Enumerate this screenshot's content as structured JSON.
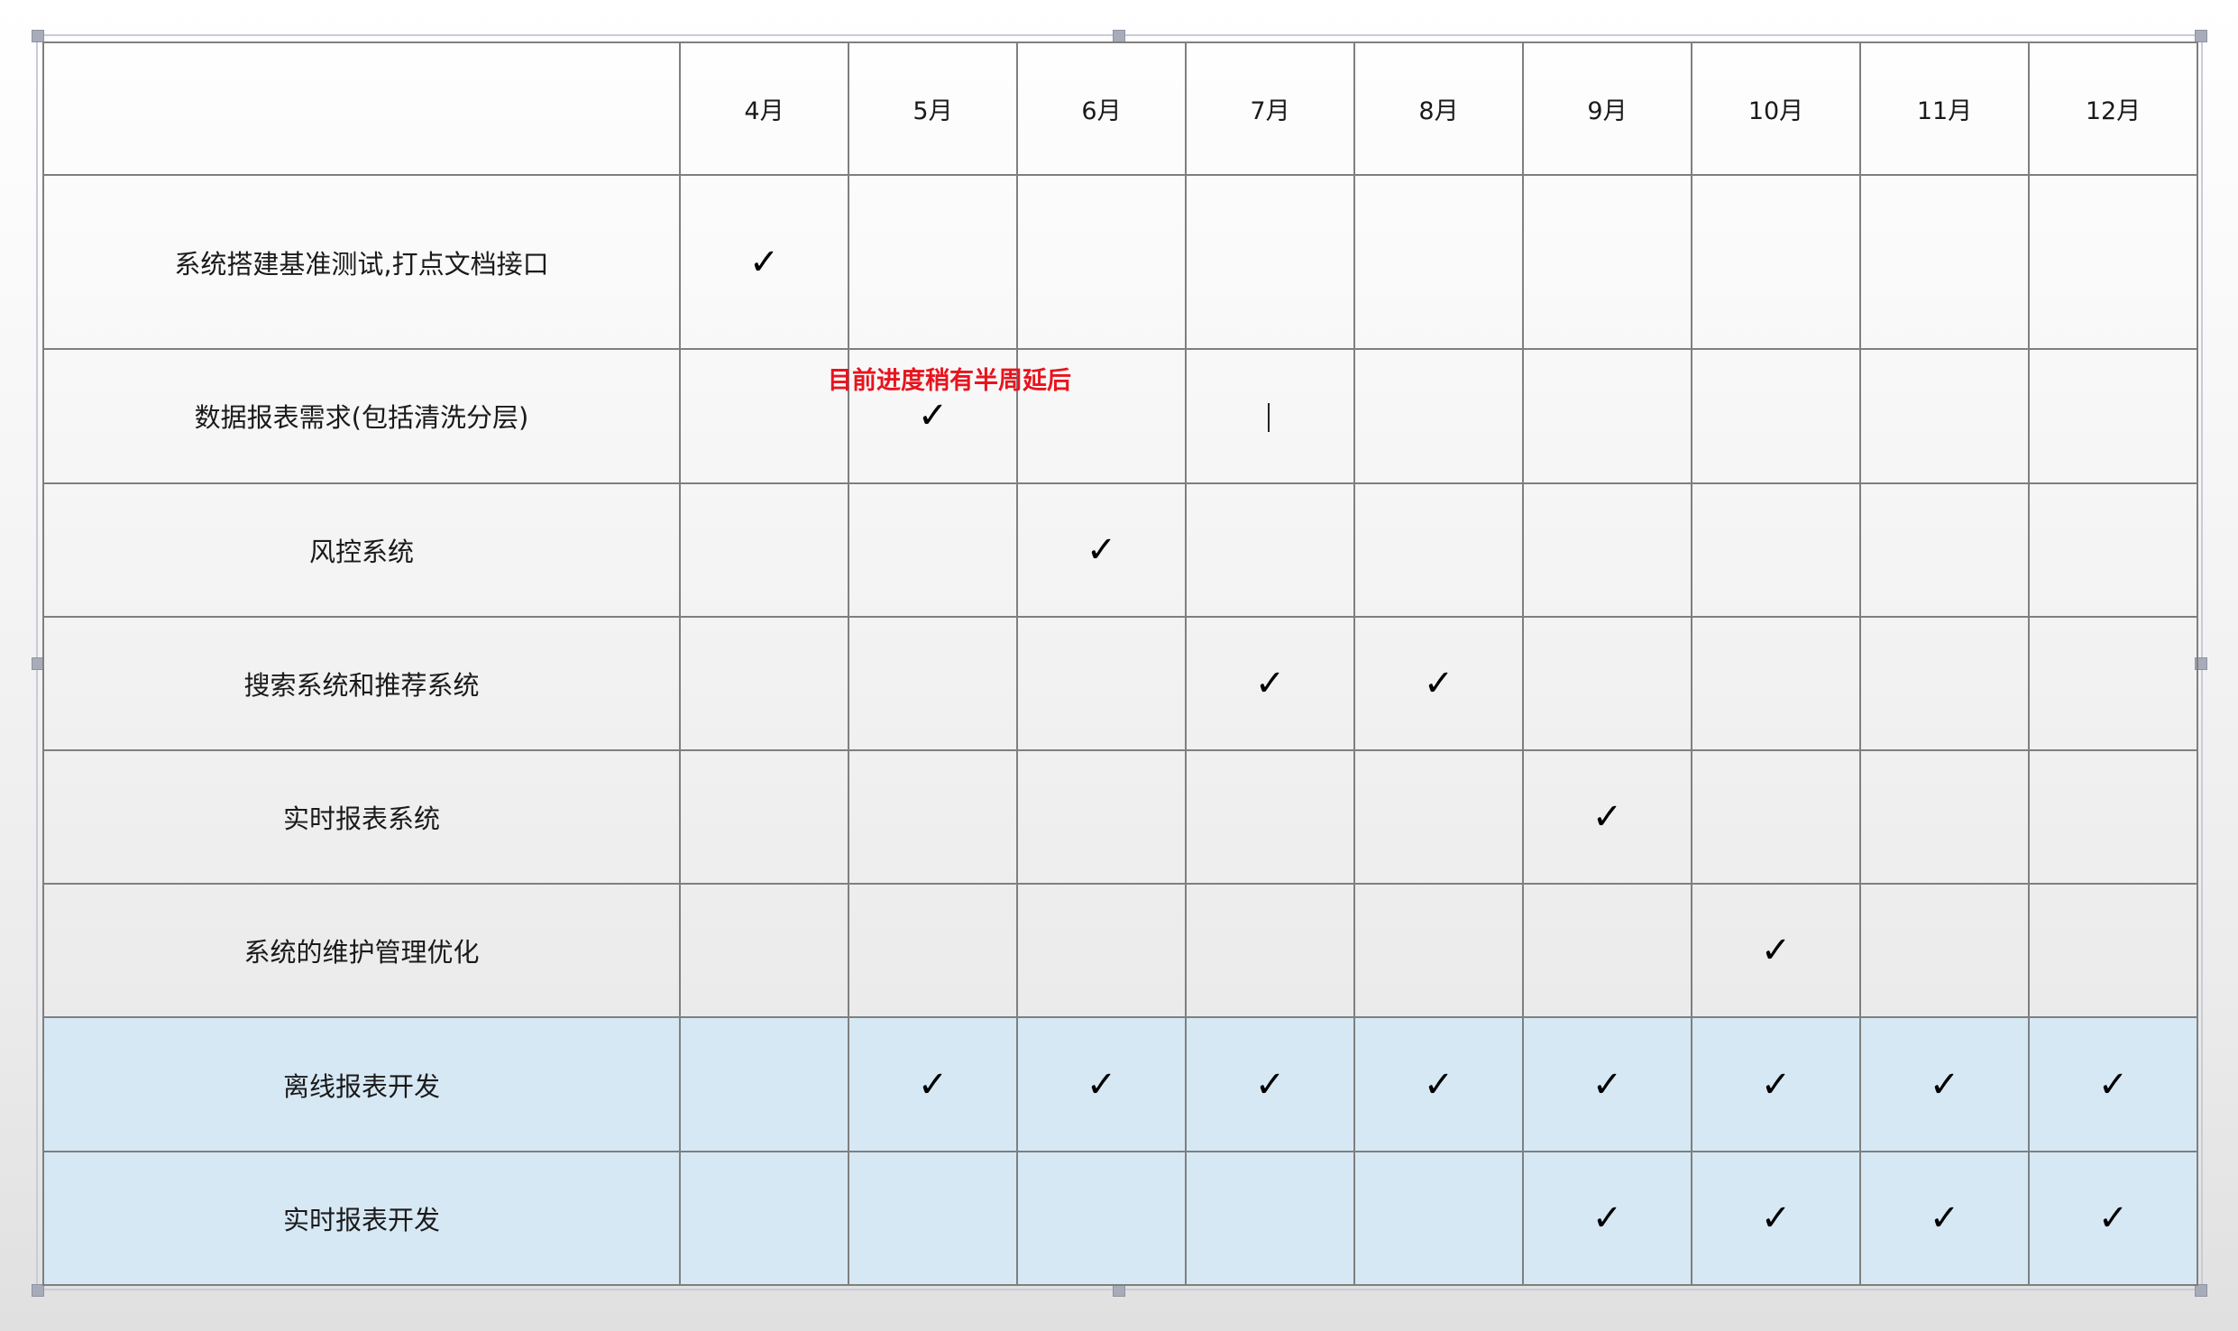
{
  "table": {
    "header": {
      "corner": "",
      "months": [
        "4月",
        "5月",
        "6月",
        "7月",
        "8月",
        "9月",
        "10月",
        "11月",
        "12月"
      ]
    },
    "rows": [
      {
        "label": "系统搭建基准测试,打点文档接口",
        "marks": [
          true,
          false,
          false,
          false,
          false,
          false,
          false,
          false,
          false
        ]
      },
      {
        "label": "数据报表需求(包括清洗分层)",
        "marks": [
          false,
          true,
          false,
          false,
          false,
          false,
          false,
          false,
          false
        ]
      },
      {
        "label": "风控系统",
        "marks": [
          false,
          false,
          true,
          false,
          false,
          false,
          false,
          false,
          false
        ]
      },
      {
        "label": "搜索系统和推荐系统",
        "marks": [
          false,
          false,
          false,
          true,
          true,
          false,
          false,
          false,
          false
        ]
      },
      {
        "label": "实时报表系统",
        "marks": [
          false,
          false,
          false,
          false,
          false,
          true,
          false,
          false,
          false
        ]
      },
      {
        "label": "系统的维护管理优化",
        "marks": [
          false,
          false,
          false,
          false,
          false,
          false,
          true,
          false,
          false
        ]
      },
      {
        "label": "离线报表开发",
        "marks": [
          false,
          true,
          true,
          true,
          true,
          true,
          true,
          true,
          true
        ]
      },
      {
        "label": "实时报表开发",
        "marks": [
          false,
          false,
          false,
          false,
          false,
          true,
          true,
          true,
          true
        ]
      }
    ],
    "check_symbol": "✓"
  },
  "annotation": {
    "text": "目前进度稍有半周延后",
    "color": "#e8141e"
  },
  "colors": {
    "grid_line": "#7f7f7f",
    "highlight_row": "#d6e8f6"
  }
}
